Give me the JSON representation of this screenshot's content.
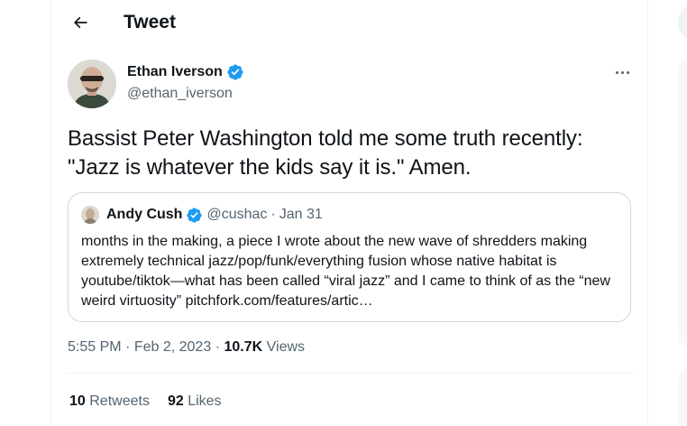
{
  "header": {
    "title": "Tweet"
  },
  "tweet": {
    "author_name": "Ethan Iverson",
    "author_handle": "@ethan_iverson",
    "text": "Bassist Peter Washington told me some truth recently: \"Jazz is whatever the kids say it is.\" Amen.",
    "time": "5:55 PM",
    "date": "Feb 2, 2023",
    "views_count": "10.7K",
    "views_label": "Views",
    "retweets_count": "10",
    "retweets_label": "Retweets",
    "likes_count": "92",
    "likes_label": "Likes"
  },
  "quote": {
    "author_name": "Andy Cush",
    "author_handle": "@cushac",
    "date": "Jan 31",
    "text": "months in the making, a piece I wrote about the new wave of shredders making extremely technical jazz/pop/funk/everything fusion whose native habitat is youtube/tiktok—what has been called “viral jazz” and I came to think of as the “new weird virtuosity” pitchfork.com/features/artic…"
  },
  "colors": {
    "text_primary": "#0f1419",
    "text_secondary": "#536471",
    "verified_blue": "#1d9bf0",
    "border": "#cfd9de"
  },
  "icons": {
    "back": "arrow-left-icon",
    "verified": "verified-badge-icon",
    "more": "more-horizontal-icon"
  }
}
